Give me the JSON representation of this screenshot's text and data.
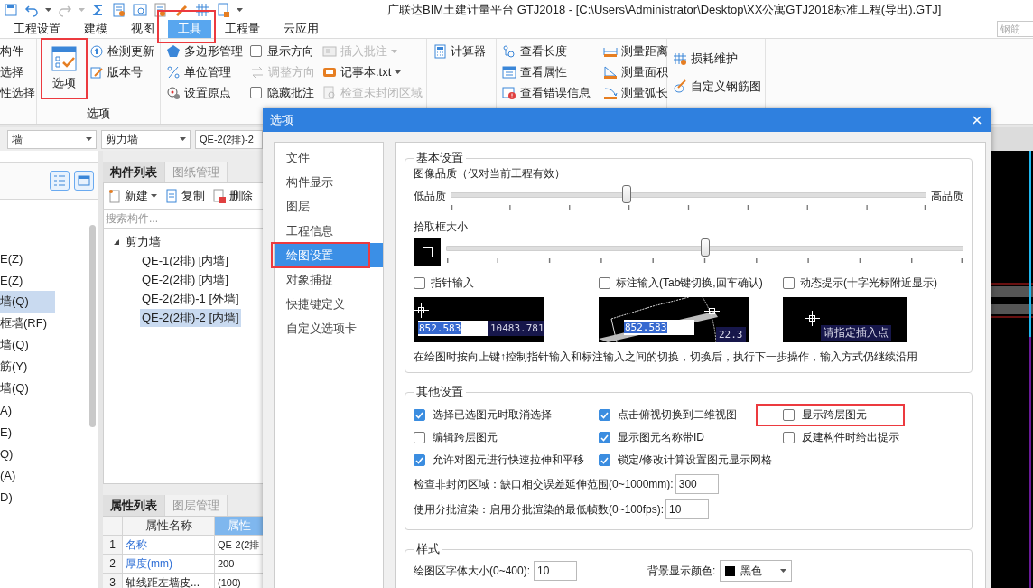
{
  "window": {
    "title": "广联达BIM土建计量平台 GTJ2018 - [C:\\Users\\Administrator\\Desktop\\XX公寓GTJ2018标准工程(导出).GTJ]"
  },
  "menu_tabs": [
    {
      "label": "工程设置",
      "selected": false,
      "highlighted": false
    },
    {
      "label": "建模",
      "selected": false,
      "highlighted": false
    },
    {
      "label": "视图",
      "selected": false,
      "highlighted": false
    },
    {
      "label": "工具",
      "selected": true,
      "highlighted": true
    },
    {
      "label": "工程量",
      "selected": false,
      "highlighted": false
    },
    {
      "label": "云应用",
      "selected": false,
      "highlighted": false
    }
  ],
  "ribbon_search": {
    "placeholder": "钢筋"
  },
  "ribbon": {
    "cut_group": [
      "构件",
      "选择",
      "性选择"
    ],
    "options_group": {
      "label": "选项",
      "main_button": {
        "label": "选项",
        "highlighted": true
      },
      "buttons": [
        {
          "label": "检测更新"
        },
        {
          "label": "版本号"
        }
      ]
    },
    "tools_columns": [
      [
        {
          "kind": "button",
          "label": "多边形管理",
          "disabled": false,
          "dropdown": false
        },
        {
          "kind": "button",
          "label": "单位管理",
          "disabled": false,
          "dropdown": false
        },
        {
          "kind": "button",
          "label": "设置原点",
          "disabled": false,
          "dropdown": false
        }
      ],
      [
        {
          "kind": "checkbox",
          "label": "显示方向",
          "checked": false
        },
        {
          "kind": "button",
          "label": "调整方向",
          "disabled": true,
          "dropdown": false
        },
        {
          "kind": "checkbox",
          "label": "隐藏批注",
          "checked": false
        }
      ],
      [
        {
          "kind": "button",
          "label": "插入批注",
          "disabled": true,
          "dropdown": true
        },
        {
          "kind": "button",
          "label": "记事本.txt",
          "disabled": false,
          "dropdown": true
        },
        {
          "kind": "button",
          "label": "检查未封闭区域",
          "disabled": true,
          "dropdown": false
        }
      ]
    ],
    "calculator": {
      "label": "计算器"
    },
    "inspect_columns": [
      [
        {
          "label": "查看长度"
        },
        {
          "label": "查看属性"
        },
        {
          "label": "查看错误信息"
        }
      ],
      [
        {
          "label": "测量距离"
        },
        {
          "label": "测量面积"
        },
        {
          "label": "测量弧长"
        }
      ]
    ],
    "rebar_buttons": [
      {
        "label": "损耗维护"
      },
      {
        "label": "自定义钢筋图"
      }
    ]
  },
  "filter_bar": {
    "combos": [
      {
        "value": "墙",
        "dropdown": true
      },
      {
        "value": "剪力墙",
        "dropdown": true
      },
      {
        "value": "QE-2(2排)-2",
        "dropdown": false
      }
    ]
  },
  "category_tree": {
    "items": [
      {
        "label": "E(Z)",
        "selected": false
      },
      {
        "label": "E(Z)",
        "selected": false
      },
      {
        "label": "墙(Q)",
        "selected": true
      },
      {
        "label": "框墙(RF)",
        "selected": false
      },
      {
        "label": "墙(Q)",
        "selected": false
      },
      {
        "label": "筋(Y)",
        "selected": false
      },
      {
        "label": "墙(Q)",
        "selected": false
      },
      {
        "label": "A)",
        "selected": false
      },
      {
        "label": "E)",
        "selected": false
      },
      {
        "label": "Q)",
        "selected": false
      },
      {
        "label": "(A)",
        "selected": false
      },
      {
        "label": "D)",
        "selected": false
      }
    ]
  },
  "component_panel": {
    "tabs": [
      {
        "label": "构件列表",
        "selected": true
      },
      {
        "label": "图纸管理",
        "selected": false
      }
    ],
    "toolbar": [
      {
        "label": "新建",
        "dropdown": true
      },
      {
        "label": "复制",
        "dropdown": false
      },
      {
        "label": "删除",
        "dropdown": false
      }
    ],
    "search": {
      "placeholder": "搜索构件..."
    },
    "tree": {
      "label": "剪力墙",
      "expanded": true,
      "children": [
        {
          "label": "QE-1(2排) [内墙]",
          "selected": false
        },
        {
          "label": "QE-2(2排) [内墙]",
          "selected": false
        },
        {
          "label": "QE-2(2排)-1 [外墙]",
          "selected": false
        },
        {
          "label": "QE-2(2排)-2 [内墙]",
          "selected": true
        }
      ]
    }
  },
  "property_panel": {
    "tabs": [
      {
        "label": "属性列表",
        "selected": true
      },
      {
        "label": "图层管理",
        "selected": false
      }
    ],
    "columns": [
      {
        "label": "属性名称",
        "selected": false
      },
      {
        "label": "属性",
        "selected": true
      }
    ],
    "rows": [
      {
        "index": "1",
        "name": "名称",
        "value": "QE-2(2排",
        "public": true
      },
      {
        "index": "2",
        "name": "厚度(mm)",
        "value": "200",
        "public": true
      },
      {
        "index": "3",
        "name": "轴线距左墙皮...",
        "value": "(100)",
        "public": false
      }
    ]
  },
  "dialog": {
    "title": "选项",
    "nav": [
      {
        "label": "文件",
        "selected": false,
        "highlighted": false
      },
      {
        "label": "构件显示",
        "selected": false,
        "highlighted": false
      },
      {
        "label": "图层",
        "selected": false,
        "highlighted": false
      },
      {
        "label": "工程信息",
        "selected": false,
        "highlighted": false
      },
      {
        "label": "绘图设置",
        "selected": true,
        "highlighted": true
      },
      {
        "label": "对象捕捉",
        "selected": false,
        "highlighted": false
      },
      {
        "label": "快捷键定义",
        "selected": false,
        "highlighted": false
      },
      {
        "label": "自定义选项卡",
        "selected": false,
        "highlighted": false
      }
    ],
    "basic": {
      "title": "基本设置",
      "quality_label": "图像品质（仅对当前工程有效）",
      "quality_low": "低品质",
      "quality_high": "高品质",
      "quality": {
        "level": 0.37
      },
      "pick_label": "拾取框大小",
      "pick": {
        "level": 0.5
      },
      "input_modes": [
        {
          "kind": "pointer",
          "label": "指针输入",
          "checked": false,
          "values": [
            "852.583",
            "10483.781"
          ]
        },
        {
          "kind": "dimension",
          "label": "标注输入(Tab键切换,回车确认)",
          "checked": false,
          "values": [
            "852.583",
            "22.3"
          ]
        },
        {
          "kind": "dynamic",
          "label": "动态提示(十字光标附近显示)",
          "checked": false,
          "values": [
            "请指定插入点"
          ]
        }
      ],
      "note": "在绘图时按向上键↑控制指针输入和标注输入之间的切换，切换后，执行下一步操作，输入方式仍继续沿用"
    },
    "other": {
      "title": "其他设置",
      "options": [
        {
          "label": "选择已选图元时取消选择",
          "checked": true,
          "highlighted": false
        },
        {
          "label": "点击俯视切换到二维视图",
          "checked": true,
          "highlighted": false
        },
        {
          "label": "显示跨层图元",
          "checked": false,
          "highlighted": true
        },
        {
          "label": "编辑跨层图元",
          "checked": false,
          "highlighted": false
        },
        {
          "label": "显示图元名称带ID",
          "checked": true,
          "highlighted": false
        },
        {
          "label": "反建构件时给出提示",
          "checked": false,
          "highlighted": false
        },
        {
          "label": "允许对图元进行快速拉伸和平移",
          "checked": true,
          "highlighted": false
        },
        {
          "label": "锁定/修改计算设置图元显示网格",
          "checked": true,
          "highlighted": false
        }
      ],
      "fields": [
        {
          "label": "检查非封闭区域：缺口相交误差延伸范围(0~1000mm):",
          "value": "300"
        },
        {
          "label": "使用分批渲染：启用分批渲染的最低帧数(0~100fps):",
          "value": "10"
        }
      ]
    },
    "style": {
      "title": "样式",
      "font_size": {
        "label": "绘图区字体大小(0~400):",
        "value": "10"
      },
      "background": {
        "label": "背景显示颜色:",
        "value": "黑色"
      }
    }
  }
}
